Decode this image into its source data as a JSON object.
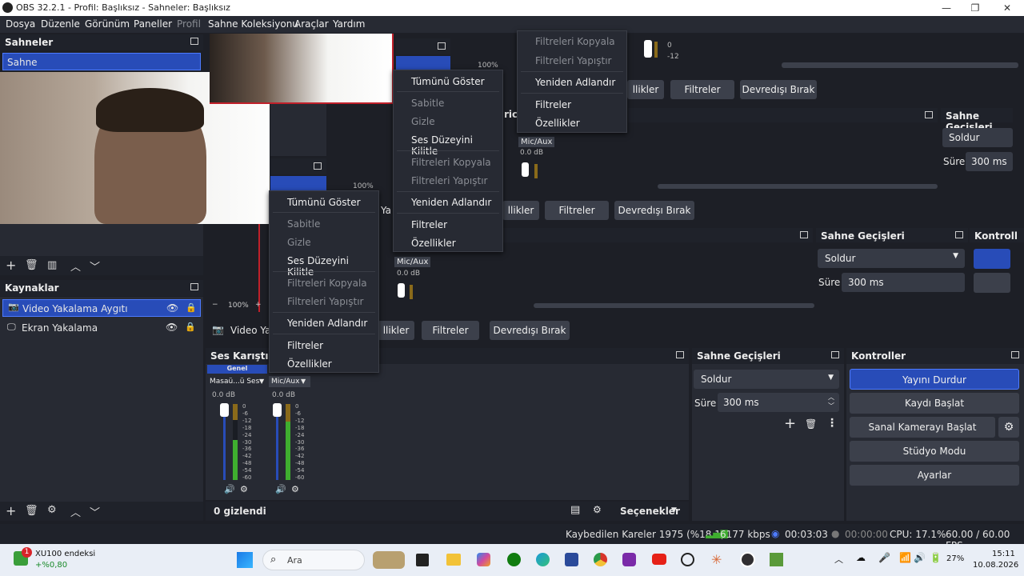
{
  "window": {
    "title": "OBS 32.2.1 - Profil: Başlıksız - Sahneler: Başlıksız"
  },
  "menu": [
    "Dosya",
    "Düzenle",
    "Görünüm",
    "Paneller",
    "Profil",
    "Sahne Koleksiyonu",
    "Araçlar",
    "Yardım"
  ],
  "scenes": {
    "title": "Sahneler",
    "items": [
      "Sahne"
    ]
  },
  "sources": {
    "title": "Kaynaklar",
    "items": [
      "Video Yakalama Aygıtı",
      "Ekran Yakalama"
    ]
  },
  "source_toolbar": {
    "label": "Video Yak",
    "filters": "Filtreler",
    "deactivate": "Devredışı Bırak",
    "props": "llikler"
  },
  "mixer": {
    "title": "Ses Karıştırıcı",
    "tab": "Genel",
    "channels": [
      {
        "name": "Masaü...ü Ses",
        "db": "0.0 dB"
      },
      {
        "name": "Mic/Aux",
        "db": "0.0 dB"
      }
    ],
    "scale": [
      "0",
      "-6",
      "-12",
      "-18",
      "-24",
      "-30",
      "-36",
      "-42",
      "-48",
      "-54",
      "-60"
    ],
    "hidden": "0 gizlendi",
    "options": "Seçenekler"
  },
  "transitions": {
    "title": "Sahne Geçişleri",
    "type": "Soldur",
    "duration_label": "Süre",
    "duration": "300 ms"
  },
  "controls": {
    "title": "Kontroller",
    "buttons": [
      "Yayını Durdur",
      "Kaydı Başlat",
      "Sanal Kamerayı Başlat",
      "Stüdyo Modu",
      "Ayarlar"
    ]
  },
  "context_menu": {
    "items": [
      "Tümünü Göster",
      "Sabitle",
      "Gizle",
      "Ses Düzeyini Kilitle",
      "Filtreleri Kopyala",
      "Filtreleri Yapıştır",
      "Yeniden Adlandır",
      "Filtreler",
      "Özellikler"
    ]
  },
  "ghost": {
    "props": "llikler",
    "mixer_short": "ric",
    "label_ya": "Ya",
    "zoom": "100%",
    "fragment_e": "e",
    "mixer_prefix": "Ses Karıştırıcı",
    "controls_short": "Kontroll",
    "sec_scale_a": [
      "0",
      "-6",
      "-12"
    ],
    "meter_scale": [
      "0",
      "-6",
      "-12"
    ]
  },
  "status": {
    "dropped": "Kaybedilen Kareler 1975 (%18.1)",
    "kbps": "6177 kbps",
    "stream_time": "00:03:03",
    "rec_time": "00:00:00",
    "cpu": "CPU: 17.1%",
    "fps": "60.00 / 60.00 FPS"
  },
  "taskbar": {
    "stock_name": "XU100 endeksi",
    "stock_change": "+%0,80",
    "search": "Ara",
    "battery": "27%",
    "time": "15:11",
    "date": "10.08.2026",
    "badge": "1"
  }
}
